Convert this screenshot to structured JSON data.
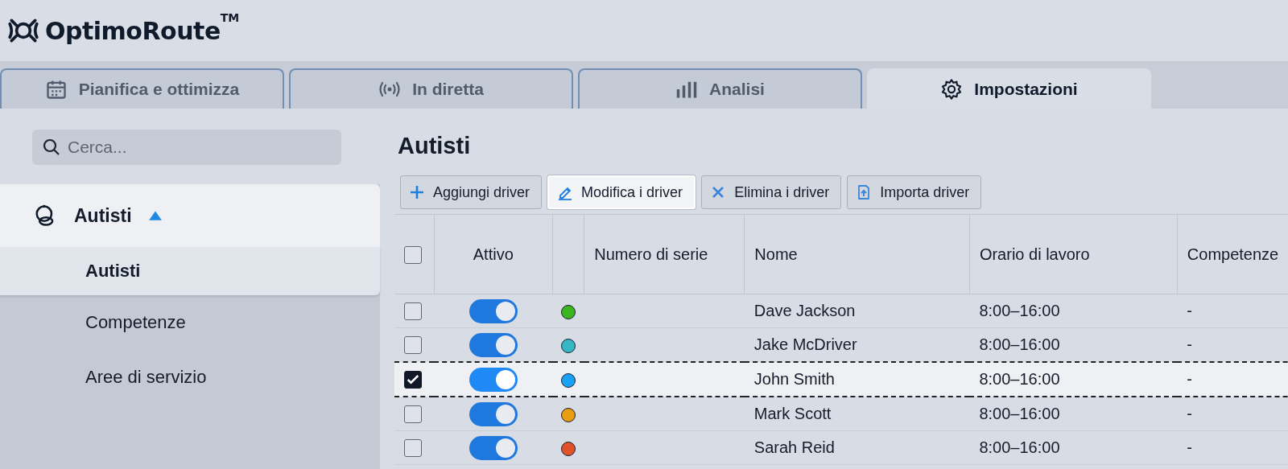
{
  "brand": {
    "name": "OptimoRoute",
    "mark": "TM"
  },
  "tabs": [
    {
      "label": "Pianifica e ottimizza",
      "selected": false
    },
    {
      "label": "In diretta",
      "selected": false
    },
    {
      "label": "Analisi",
      "selected": false
    },
    {
      "label": "Impostazioni",
      "selected": true
    }
  ],
  "sidebar": {
    "search": {
      "placeholder": "Cerca..."
    },
    "section": {
      "label": "Autisti",
      "expanded": true
    },
    "items": [
      {
        "label": "Autisti",
        "selected": true
      },
      {
        "label": "Competenze",
        "selected": false
      },
      {
        "label": "Aree di servizio",
        "selected": false
      }
    ]
  },
  "main": {
    "title": "Autisti",
    "toolbar": [
      {
        "label": "Aggiungi driver",
        "highlighted": false
      },
      {
        "label": "Modifica i driver",
        "highlighted": true
      },
      {
        "label": "Elimina i driver",
        "highlighted": false
      },
      {
        "label": "Importa driver",
        "highlighted": false
      }
    ],
    "table": {
      "all_checked": false,
      "columns": [
        "Attivo",
        "Numero di serie",
        "Nome",
        "Orario di lavoro",
        "Competenze"
      ],
      "rows": [
        {
          "checked": false,
          "active": true,
          "color": "#3cb521",
          "name": "Dave Jackson",
          "hours": "8:00–16:00",
          "skills": "-",
          "selected": false
        },
        {
          "checked": false,
          "active": true,
          "color": "#36b8c4",
          "name": "Jake McDriver",
          "hours": "8:00–16:00",
          "skills": "-",
          "selected": false
        },
        {
          "checked": true,
          "active": true,
          "color": "#1aa0f5",
          "name": "John Smith",
          "hours": "8:00–16:00",
          "skills": "-",
          "selected": true
        },
        {
          "checked": false,
          "active": true,
          "color": "#e89d12",
          "name": "Mark Scott",
          "hours": "8:00–16:00",
          "skills": "-",
          "selected": false
        },
        {
          "checked": false,
          "active": true,
          "color": "#e0522a",
          "name": "Sarah Reid",
          "hours": "8:00–16:00",
          "skills": "-",
          "selected": false
        }
      ]
    }
  }
}
